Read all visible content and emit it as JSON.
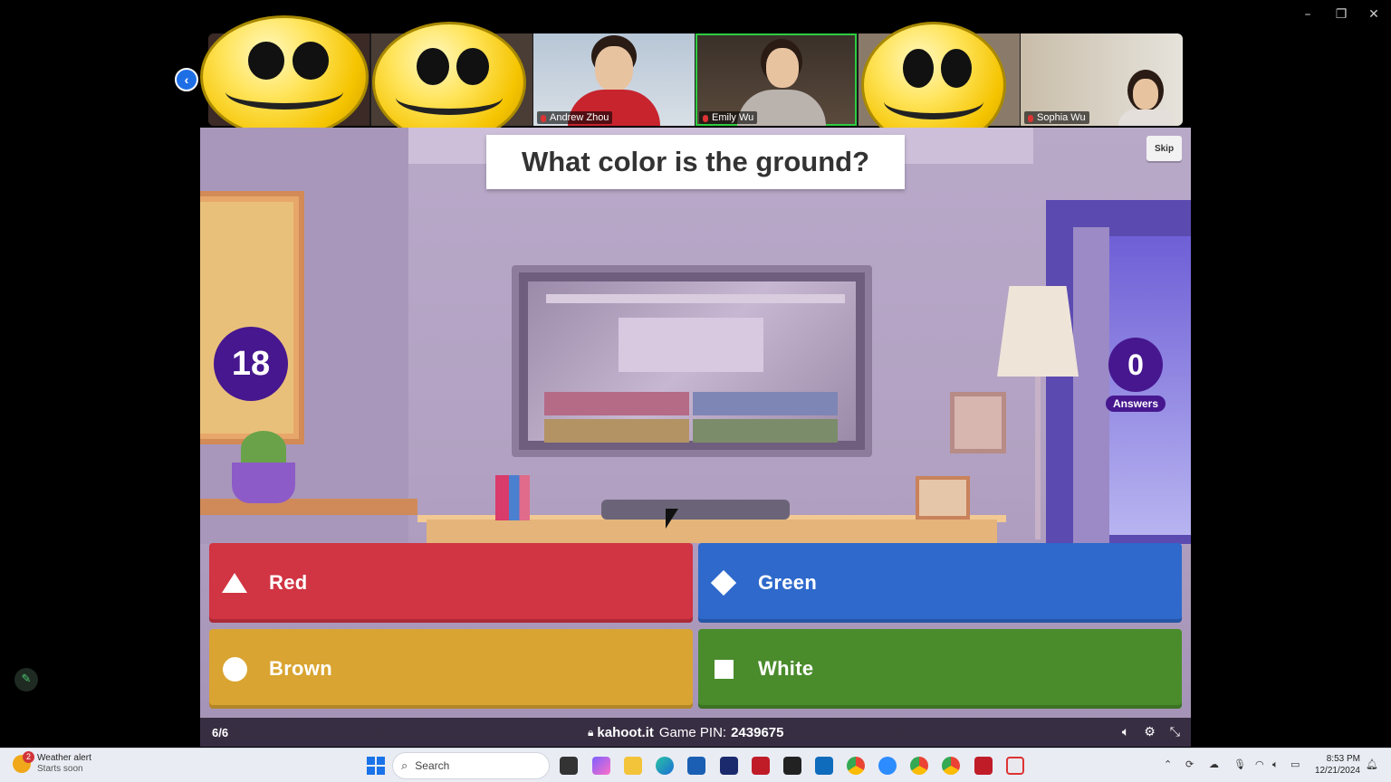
{
  "window": {
    "minimize": "–",
    "restore": "❐",
    "close": "✕"
  },
  "participants": [
    {
      "name": "Andrew Zhou"
    },
    {
      "name": "Emily Wu",
      "active": true
    },
    {
      "name": "Sophia Wu"
    }
  ],
  "kahoot": {
    "question": "What color is the ground?",
    "skip_label": "Skip",
    "timer": "18",
    "answers_count": "0",
    "answers_label": "Answers",
    "options": [
      {
        "label": "Red",
        "shape": "triangle",
        "color": "#d13442"
      },
      {
        "label": "Green",
        "shape": "diamond",
        "color": "#2e69cb"
      },
      {
        "label": "Brown",
        "shape": "circle",
        "color": "#d9a431"
      },
      {
        "label": "White",
        "shape": "square",
        "color": "#4a8b2c"
      }
    ],
    "footer": {
      "progress": "6/6",
      "site": "kahoot.it",
      "pin_label": "Game PIN:",
      "pin": "2439675"
    }
  },
  "taskbar": {
    "weather_badge": "2",
    "weather_title": "Weather alert",
    "weather_sub": "Starts soon",
    "search_placeholder": "Search",
    "time": "8:53 PM",
    "date": "12/21/2024"
  }
}
